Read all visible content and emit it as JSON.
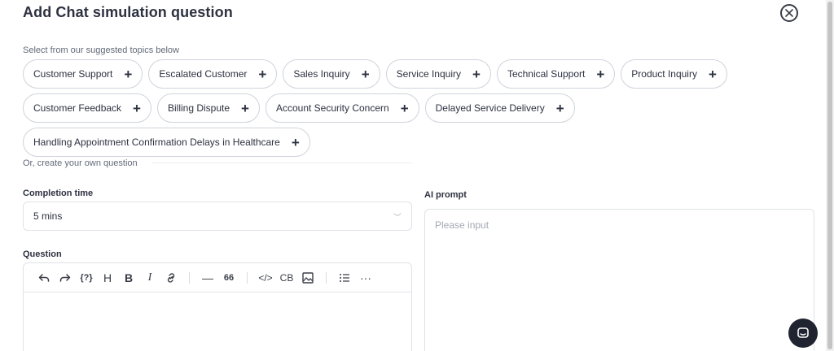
{
  "modal": {
    "title": "Add Chat simulation question"
  },
  "topics": {
    "label": "Select from our suggested topics below",
    "chips": [
      {
        "label": "Customer Support"
      },
      {
        "label": "Escalated Customer"
      },
      {
        "label": "Sales Inquiry"
      },
      {
        "label": "Service Inquiry"
      },
      {
        "label": "Technical Support"
      },
      {
        "label": "Product Inquiry"
      },
      {
        "label": "Customer Feedback"
      },
      {
        "label": "Billing Dispute"
      },
      {
        "label": "Account Security Concern"
      },
      {
        "label": "Delayed Service Delivery"
      },
      {
        "label": "Handling Appointment Confirmation Delays in Healthcare"
      }
    ],
    "add_symbol": "+"
  },
  "custom": {
    "label": "Or, create your own question"
  },
  "completion_time": {
    "label": "Completion time",
    "value": "5 mins",
    "chevron": "﹀"
  },
  "question": {
    "label": "Question",
    "toolbar": [
      "undo-icon",
      "redo-icon",
      "variable-icon",
      "heading-icon",
      "bold-icon",
      "italic-icon",
      "link-icon",
      "horizontal-rule-icon",
      "quote-icon",
      "code-icon",
      "code-block-icon",
      "image-icon",
      "bullet-list-icon",
      "more-icon"
    ],
    "toolbar_text": {
      "variable": "{?}",
      "heading": "H",
      "bold": "B",
      "italic": "I",
      "hr": "—",
      "quote": "66",
      "code": "</>",
      "code_block": "CB",
      "more": "···"
    }
  },
  "ai_prompt": {
    "label": "AI prompt",
    "placeholder": "Please input"
  },
  "colors": {
    "text": "#2d3140",
    "muted": "#626a78",
    "border": "#cfd3da",
    "fab": "#1f2430"
  }
}
